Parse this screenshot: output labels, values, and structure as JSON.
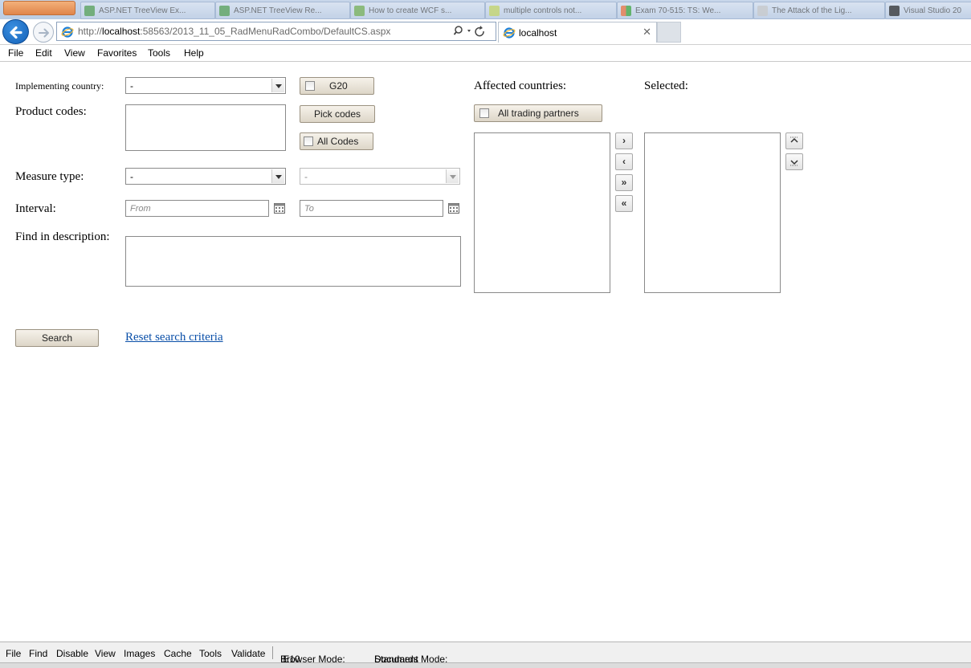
{
  "browser": {
    "taskbar_tabs": [
      "ASP.NET TreeView Ex...",
      "ASP.NET TreeView Re...",
      "How to create WCF s...",
      "multiple controls not...",
      "Exam 70-515: TS: We...",
      "The Attack of the Lig...",
      "Visual Studio 20"
    ],
    "url_prefix": "http://",
    "url_host": "localhost",
    "url_rest": ":58563/2013_11_05_RadMenuRadCombo/DefaultCS.aspx",
    "tab_title": "localhost",
    "menu": [
      "File",
      "Edit",
      "View",
      "Favorites",
      "Tools",
      "Help"
    ]
  },
  "form": {
    "implementing_country_label": "Implementing country:",
    "implementing_country_value": "-",
    "g20_label": "G20",
    "product_codes_label": "Product codes:",
    "pick_codes_label": "Pick codes",
    "all_codes_label": "All Codes",
    "measure_type_label": "Measure type:",
    "measure_type_value": "-",
    "measure_subtype_value": "-",
    "interval_label": "Interval:",
    "from_placeholder": "From",
    "to_placeholder": "To",
    "find_description_label": "Find in description:",
    "affected_countries_label": "Affected countries:",
    "selected_label": "Selected:",
    "all_trading_partners_label": "All trading partners",
    "search_button": "Search",
    "reset_link": "Reset search criteria"
  },
  "devtools": {
    "items": [
      "File",
      "Find",
      "Disable",
      "View",
      "Images",
      "Cache",
      "Tools",
      "Validate"
    ],
    "browser_mode_label": "Browser Mode:",
    "browser_mode_value": "IE10",
    "document_mode_label": "Document Mode:",
    "document_mode_value": "Standards"
  }
}
